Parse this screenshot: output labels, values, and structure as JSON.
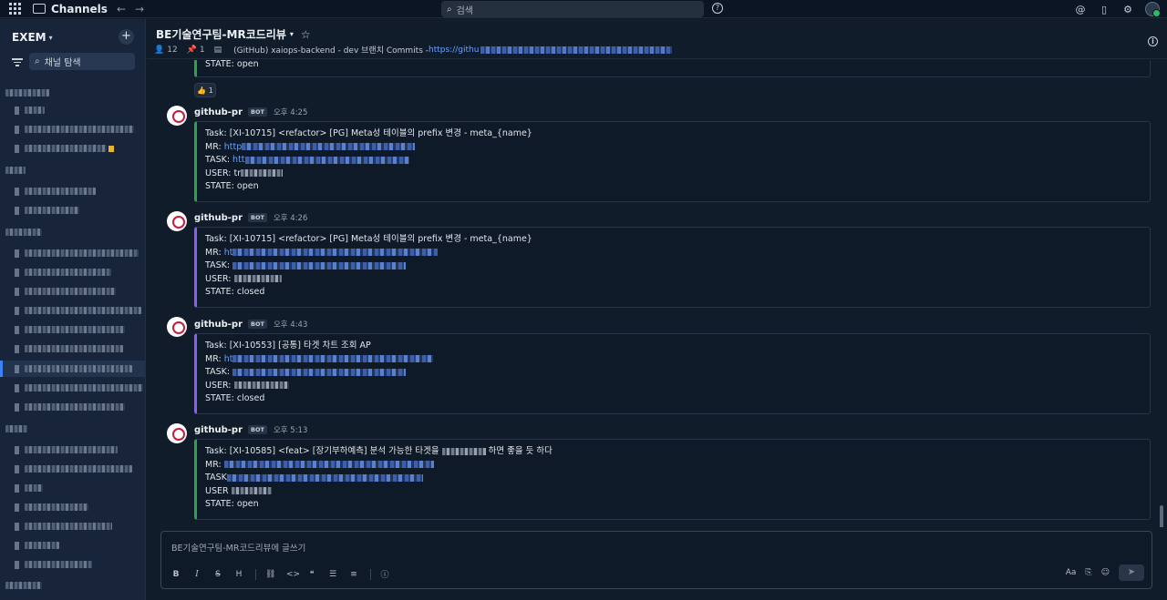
{
  "topbar": {
    "title": "Channels",
    "back_icon": "←",
    "forward_icon": "→",
    "search_placeholder": "검색",
    "help_icon": "?",
    "mentions_icon": "@",
    "saved_icon": "▯",
    "settings_icon": "⚙"
  },
  "sidebar": {
    "workspace": "EXEM",
    "workspace_caret": "▾",
    "add_icon": "+",
    "search_placeholder": "채널 탐색"
  },
  "channel": {
    "title": "BE기술연구팀-MR코드리뷰",
    "caret": "▾",
    "star": "☆",
    "members": "12",
    "pinned": "1",
    "description": "(GitHub) xaiops-backend - dev 브랜치 Commits - ",
    "link_prefix": "https://githu",
    "info_icon": "i"
  },
  "messages": {
    "top_state": "STATE: open",
    "reaction": "👍 1",
    "items": [
      {
        "author": "github-pr",
        "bot": "BOT",
        "time": "오후 4:25",
        "task_title": "Task: [XI-10715] <refactor> [PG] Meta성 테이블의 prefix 변경 - meta_{name}",
        "mr_label": "MR: ",
        "mr_link": "http",
        "task_label": "TASK: ",
        "task_link": "htt",
        "user_label": "USER: tr",
        "state": "STATE: open"
      },
      {
        "author": "github-pr",
        "bot": "BOT",
        "time": "오후 4:26",
        "task_title": "Task: [XI-10715] <refactor> [PG] Meta성 테이블의 prefix 변경 - meta_{name}",
        "mr_label": "MR: ",
        "mr_link": "ht",
        "task_label": "TASK: ",
        "task_link": "",
        "user_label": "USER: ",
        "state": "STATE: closed"
      },
      {
        "author": "github-pr",
        "bot": "BOT",
        "time": "오후 4:43",
        "task_title": "Task: [XI-10553] [공통] 타겟 차트 조회 AP",
        "mr_label": "MR: ",
        "mr_link": "ht",
        "task_label": "TASK: ",
        "task_link": "",
        "user_label": "USER: ",
        "state": "STATE: closed"
      },
      {
        "author": "github-pr",
        "bot": "BOT",
        "time": "오후 5:13",
        "task_title": "Task: [XI-10585] <feat> [장기부하예측] 분석 가능한 타겟을",
        "task_title_tail": "하면 좋을 듯 하다",
        "mr_label": "MR: ",
        "mr_link": "",
        "task_label": "TASK",
        "task_link": "",
        "user_label": "USER ",
        "state": "STATE: open"
      }
    ]
  },
  "composer": {
    "placeholder": "BE기술연구팀-MR코드리뷰에 글쓰기",
    "bold": "B",
    "italic": "I",
    "strike": "S",
    "heading": "H",
    "link": "⛓",
    "code": "<>",
    "quote": "❝",
    "bullet": "☰",
    "numbered": "≡",
    "emoji_info": "ⓘ",
    "format": "Aa",
    "attach": "⎘",
    "emoji": "☺",
    "send": "➤"
  },
  "colors": {
    "open_bar": "#2aa34a",
    "closed_bar": "#8b5cf6",
    "link": "#6aa0ff",
    "accent": "#3b82f6"
  }
}
